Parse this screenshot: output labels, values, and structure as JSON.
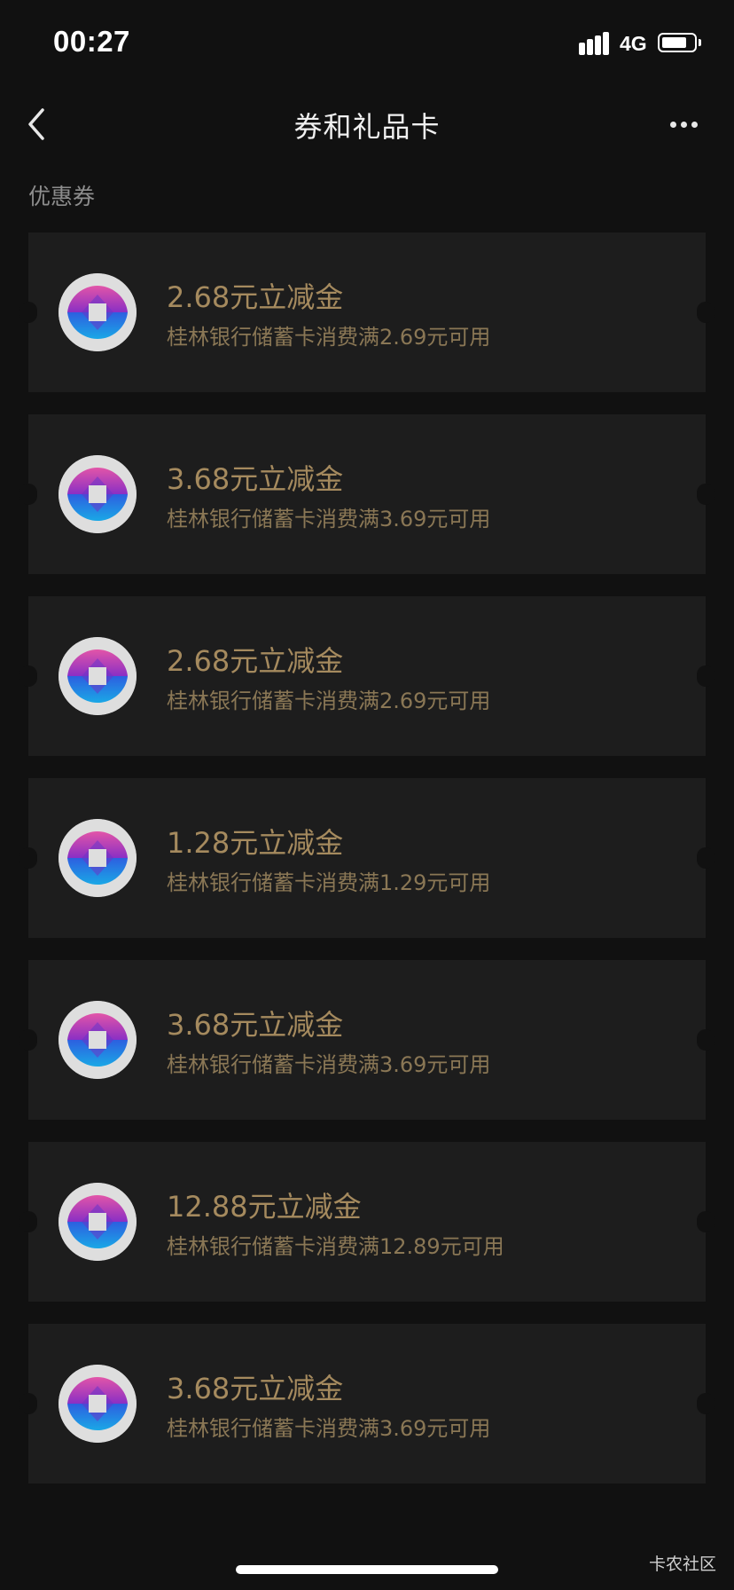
{
  "status_bar": {
    "time": "00:27",
    "network": "4G",
    "battery_level": 0.72
  },
  "nav": {
    "title": "券和礼品卡",
    "back_icon": "chevron-left-icon",
    "more_icon": "more-horizontal-icon"
  },
  "section": {
    "label": "优惠券"
  },
  "coupons": [
    {
      "title": "2.68元立减金",
      "desc": "桂林银行储蓄卡消费满2.69元可用"
    },
    {
      "title": "3.68元立减金",
      "desc": "桂林银行储蓄卡消费满3.69元可用"
    },
    {
      "title": "2.68元立减金",
      "desc": "桂林银行储蓄卡消费满2.69元可用"
    },
    {
      "title": "1.28元立减金",
      "desc": "桂林银行储蓄卡消费满1.29元可用"
    },
    {
      "title": "3.68元立减金",
      "desc": "桂林银行储蓄卡消费满3.69元可用"
    },
    {
      "title": "12.88元立减金",
      "desc": "桂林银行储蓄卡消费满12.89元可用"
    },
    {
      "title": "3.68元立减金",
      "desc": "桂林银行储蓄卡消费满3.69元可用"
    }
  ],
  "watermark": "卡农社区",
  "colors": {
    "background": "#111111",
    "card": "#1d1d1d",
    "gold_title": "#a58a5e",
    "gold_desc": "#8a7755"
  }
}
